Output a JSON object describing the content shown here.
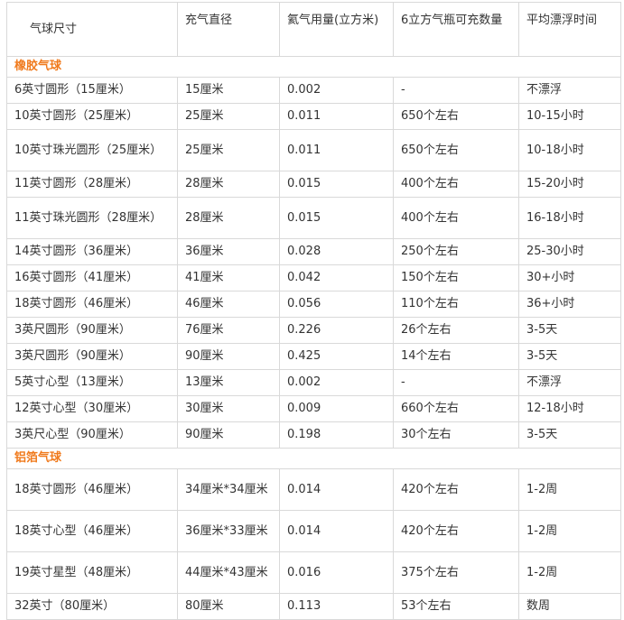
{
  "headers": [
    "气球尺寸",
    "充气直径",
    "氦气用量(立方米)",
    "6立方气瓶可充数量",
    "平均漂浮时间"
  ],
  "sections": [
    {
      "title": "橡胶气球",
      "rows": [
        [
          "6英寸圆形（15厘米）",
          "15厘米",
          "0.002",
          "-",
          "不漂浮"
        ],
        [
          "10英寸圆形（25厘米）",
          "25厘米",
          "0.011",
          "650个左右",
          "10-15小时"
        ],
        [
          "10英寸珠光圆形（25厘米）",
          "25厘米",
          "0.011",
          "650个左右",
          "10-18小时"
        ],
        [
          "11英寸圆形（28厘米）",
          "28厘米",
          "0.015",
          "400个左右",
          "15-20小时"
        ],
        [
          "11英寸珠光圆形（28厘米）",
          "28厘米",
          "0.015",
          "400个左右",
          "16-18小时"
        ],
        [
          "14英寸圆形（36厘米）",
          "36厘米",
          "0.028",
          "250个左右",
          "25-30小时"
        ],
        [
          "16英寸圆形（41厘米）",
          "41厘米",
          "0.042",
          "150个左右",
          "30+小时"
        ],
        [
          "18英寸圆形（46厘米）",
          "46厘米",
          "0.056",
          "110个左右",
          "36+小时"
        ],
        [
          "3英尺圆形（90厘米）",
          "76厘米",
          "0.226",
          "26个左右",
          "3-5天"
        ],
        [
          "3英尺圆形（90厘米）",
          "90厘米",
          "0.425",
          "14个左右",
          "3-5天"
        ],
        [
          "5英寸心型（13厘米）",
          "13厘米",
          "0.002",
          "-",
          "不漂浮"
        ],
        [
          "12英寸心型（30厘米）",
          "30厘米",
          "0.009",
          "660个左右",
          "12-18小时"
        ],
        [
          "3英尺心型（90厘米）",
          "90厘米",
          "0.198",
          "30个左右",
          "3-5天"
        ]
      ]
    },
    {
      "title": "铝箔气球",
      "rows": [
        [
          "18英寸圆形（46厘米）",
          "34厘米*34厘米",
          "0.014",
          "420个左右",
          "1-2周"
        ],
        [
          "18英寸心型（46厘米）",
          "36厘米*33厘米",
          "0.014",
          "420个左右",
          "1-2周"
        ],
        [
          "19英寸星型（48厘米）",
          "44厘米*43厘米",
          "0.016",
          "375个左右",
          "1-2周"
        ],
        [
          "32英寸（80厘米）",
          "80厘米",
          "0.113",
          "53个左右",
          "数周"
        ]
      ]
    }
  ],
  "colors": {
    "section_title": "#f07a1c",
    "border": "#d9d9d9",
    "text": "#333333"
  }
}
